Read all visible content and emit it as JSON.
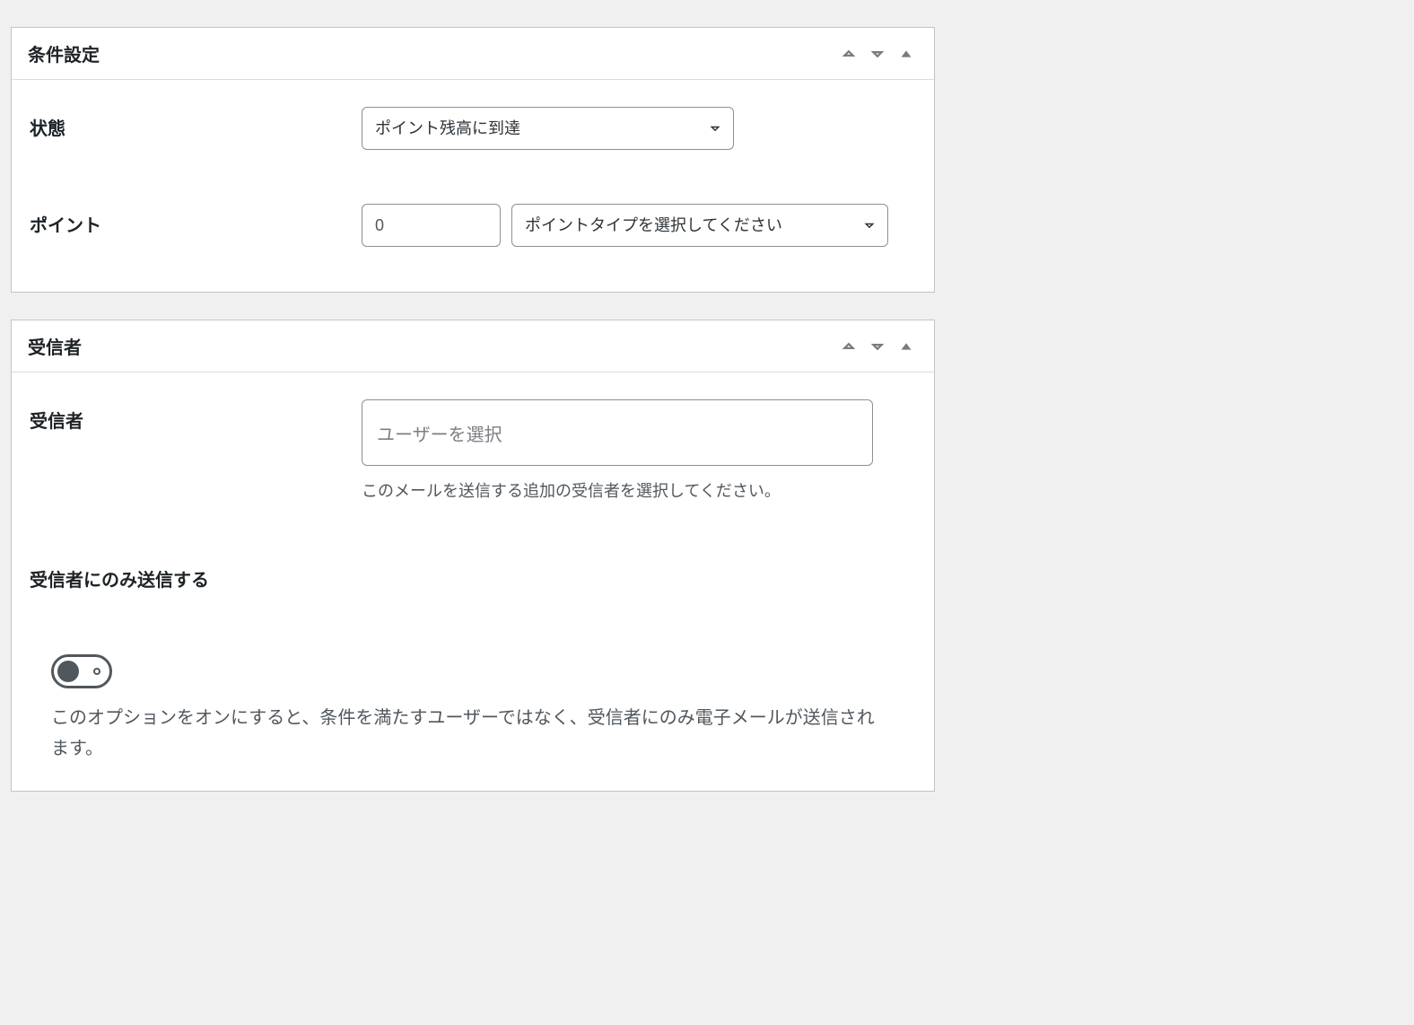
{
  "panels": {
    "conditions": {
      "title": "条件設定",
      "fields": {
        "status": {
          "label": "状態",
          "selected": "ポイント残高に到達"
        },
        "points": {
          "label": "ポイント",
          "value": "0",
          "typeSelected": "ポイントタイプを選択してください"
        }
      }
    },
    "recipients": {
      "title": "受信者",
      "fields": {
        "recipient": {
          "label": "受信者",
          "placeholder": "ユーザーを選択",
          "help": "このメールを送信する追加の受信者を選択してください。"
        },
        "onlyRecipients": {
          "label": "受信者にのみ送信する",
          "description": "このオプションをオンにすると、条件を満たすユーザーではなく、受信者にのみ電子メールが送信されます。",
          "value": false
        }
      }
    }
  }
}
